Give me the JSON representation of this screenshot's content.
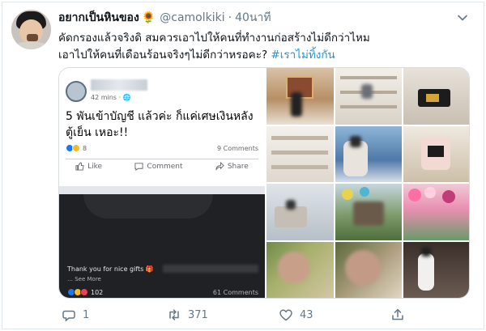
{
  "tweet": {
    "author_name": "อยากเป็นหินของ",
    "author_emoji": "🌻",
    "handle": "@camolkiki",
    "separator": "·",
    "time": "40นาที",
    "text_line1": "คัดกรองแล้วจริงดิ  สมควรเอาไปให้คนที่ทำงานก่อสร้างไม่ดีกว่าไหม",
    "text_line2": "เอาไปให้คนที่เดือนร้อนจริงๆไม่ดีกว่าหรอคะ?",
    "hashtag": "#เราไม่ทิ้งกัน"
  },
  "fb_post": {
    "time_meta": "42 mins · ",
    "message": "5 พันเข้าบัญชี แล้วค่ะ ก็แค่เศษเงินหลังตู้เย็น เหอะ!!",
    "reaction_count": "8",
    "comment_count": "9 Comments",
    "like_label": "Like",
    "comment_label": "Comment",
    "share_label": "Share"
  },
  "fb_post2": {
    "caption": "Thank you for nice gifts 🎁",
    "see_more": "… See More",
    "reaction_count": "102",
    "comment_count": "61 Comments"
  },
  "actions": {
    "reply_count": "1",
    "retweet_count": "371",
    "like_count": "43"
  },
  "colors": {
    "link_blue": "#1b95e0",
    "secondary_text": "#657786"
  }
}
